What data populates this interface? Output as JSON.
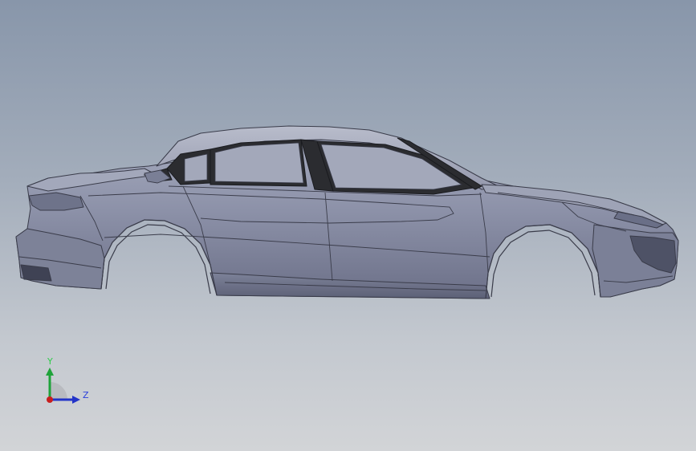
{
  "viewport": {
    "colors": {
      "background_top": "#8896aa",
      "background_bottom": "#d2d4d7",
      "model_fill": "#8a8fa6",
      "model_edge": "#3a3c4a",
      "glass": "#2b2c30"
    }
  },
  "triad": {
    "y_label": "Y",
    "z_label": "Z",
    "colors": {
      "y_axis": "#1fa33a",
      "z_axis": "#2233c8",
      "x_axis": "#c81e1e",
      "y_label": "#2fcc4a",
      "z_label": "#2a3fdc"
    }
  }
}
